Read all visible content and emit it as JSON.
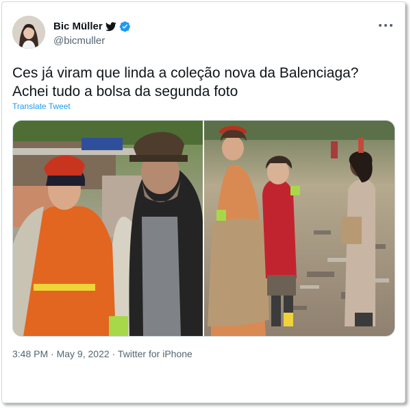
{
  "author": {
    "name": "Bic Müller",
    "handle": "@bicmuller",
    "verified": true,
    "icons": [
      "bird-icon",
      "verified-icon"
    ]
  },
  "tweet": {
    "text_lines": [
      "Ces já viram que linda a coleção nova da Balenciaga?",
      "Achei tudo a bolsa da segunda foto"
    ],
    "translate_label": "Translate Tweet",
    "media_count": 2
  },
  "meta": {
    "time": "3:48 PM",
    "date": "May 9, 2022",
    "source": "Twitter for iPhone",
    "separator": " · "
  },
  "colors": {
    "text": "#0f1419",
    "secondary": "#536471",
    "link": "#1d9bf0",
    "verified": "#1d9bf0"
  }
}
